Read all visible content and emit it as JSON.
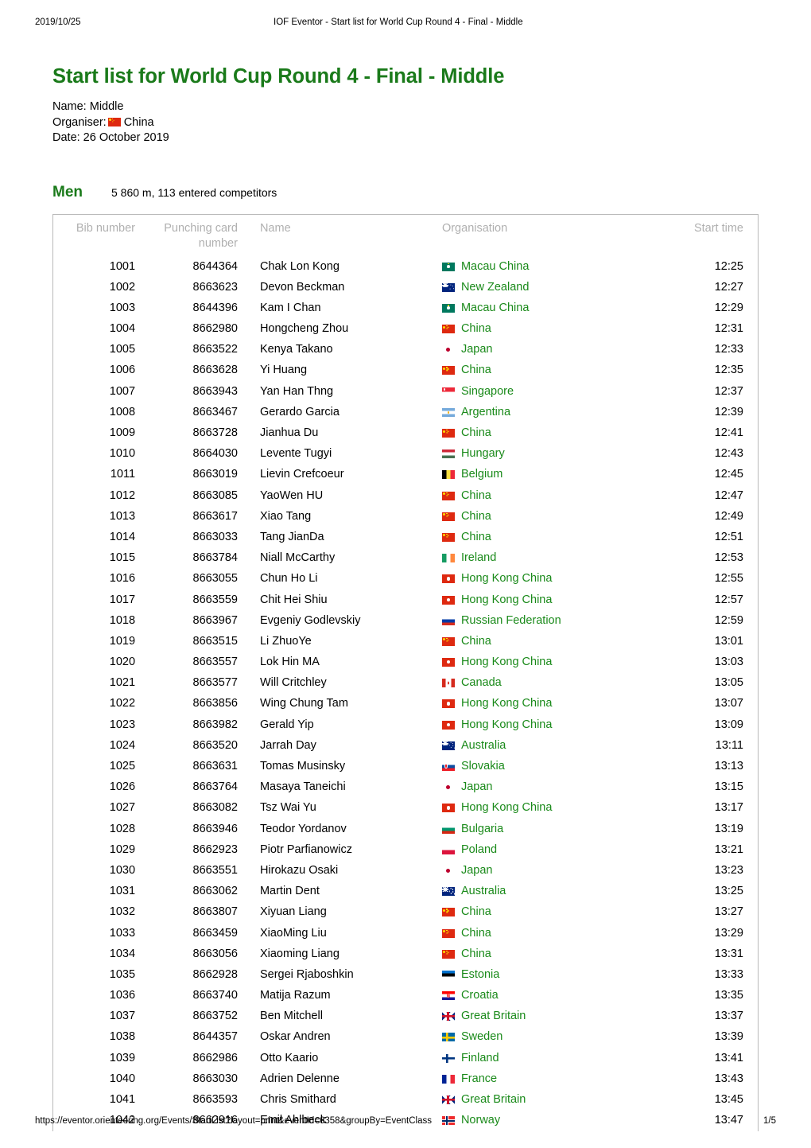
{
  "print_header": {
    "date": "2019/10/25",
    "title": "IOF Eventor - Start list for World Cup Round 4 - Final - Middle"
  },
  "print_footer": {
    "url": "https://eventor.orienteering.org/Events/StartList?layout=print&eventId=6358&groupBy=EventClass",
    "page": "1/5"
  },
  "document": {
    "title": "Start list for World Cup Round 4 - Final - Middle",
    "title_color": "#1a7a1a",
    "meta": {
      "name_label": "Name: Middle",
      "organiser_label": "Organiser:",
      "organiser_country": "China",
      "organiser_flag": "china-flag-icon",
      "date_label": "Date: 26 October 2019"
    }
  },
  "class_section": {
    "class_name": "Men",
    "class_info": "5 860 m, 113 entered competitors"
  },
  "table": {
    "headers": {
      "bib": "Bib number",
      "card": "Punching card number",
      "name": "Name",
      "organisation": "Organisation",
      "start_time": "Start time"
    },
    "header_color": "#b0b0b0",
    "link_color": "#1a8a1a",
    "rows": [
      {
        "bib": "1001",
        "card": "8644364",
        "name": "Chak Lon Kong",
        "org": "Macau China",
        "flag": "macau",
        "time": "12:25"
      },
      {
        "bib": "1002",
        "card": "8663623",
        "name": "Devon Beckman",
        "org": "New Zealand",
        "flag": "newzealand",
        "time": "12:27"
      },
      {
        "bib": "1003",
        "card": "8644396",
        "name": "Kam I Chan",
        "org": "Macau China",
        "flag": "macau",
        "time": "12:29"
      },
      {
        "bib": "1004",
        "card": "8662980",
        "name": "Hongcheng Zhou",
        "org": "China",
        "flag": "china",
        "time": "12:31"
      },
      {
        "bib": "1005",
        "card": "8663522",
        "name": "Kenya Takano",
        "org": "Japan",
        "flag": "japan",
        "time": "12:33"
      },
      {
        "bib": "1006",
        "card": "8663628",
        "name": "Yi Huang",
        "org": "China",
        "flag": "china",
        "time": "12:35"
      },
      {
        "bib": "1007",
        "card": "8663943",
        "name": "Yan Han Thng",
        "org": "Singapore",
        "flag": "singapore",
        "time": "12:37"
      },
      {
        "bib": "1008",
        "card": "8663467",
        "name": "Gerardo Garcia",
        "org": "Argentina",
        "flag": "argentina",
        "time": "12:39"
      },
      {
        "bib": "1009",
        "card": "8663728",
        "name": "Jianhua Du",
        "org": "China",
        "flag": "china",
        "time": "12:41"
      },
      {
        "bib": "1010",
        "card": "8664030",
        "name": "Levente Tugyi",
        "org": "Hungary",
        "flag": "hungary",
        "time": "12:43"
      },
      {
        "bib": "1011",
        "card": "8663019",
        "name": "Lievin Crefcoeur",
        "org": "Belgium",
        "flag": "belgium",
        "time": "12:45"
      },
      {
        "bib": "1012",
        "card": "8663085",
        "name": "YaoWen HU",
        "org": "China",
        "flag": "china",
        "time": "12:47"
      },
      {
        "bib": "1013",
        "card": "8663617",
        "name": "Xiao Tang",
        "org": "China",
        "flag": "china",
        "time": "12:49"
      },
      {
        "bib": "1014",
        "card": "8663033",
        "name": "Tang JianDa",
        "org": "China",
        "flag": "china",
        "time": "12:51"
      },
      {
        "bib": "1015",
        "card": "8663784",
        "name": "Niall McCarthy",
        "org": "Ireland",
        "flag": "ireland",
        "time": "12:53"
      },
      {
        "bib": "1016",
        "card": "8663055",
        "name": "Chun Ho Li",
        "org": "Hong Kong China",
        "flag": "hongkong",
        "time": "12:55"
      },
      {
        "bib": "1017",
        "card": "8663559",
        "name": "Chit Hei Shiu",
        "org": "Hong Kong China",
        "flag": "hongkong",
        "time": "12:57"
      },
      {
        "bib": "1018",
        "card": "8663967",
        "name": "Evgeniy Godlevskiy",
        "org": "Russian Federation",
        "flag": "russia",
        "time": "12:59"
      },
      {
        "bib": "1019",
        "card": "8663515",
        "name": "Li ZhuoYe",
        "org": "China",
        "flag": "china",
        "time": "13:01"
      },
      {
        "bib": "1020",
        "card": "8663557",
        "name": "Lok Hin MA",
        "org": "Hong Kong China",
        "flag": "hongkong",
        "time": "13:03"
      },
      {
        "bib": "1021",
        "card": "8663577",
        "name": "Will Critchley",
        "org": "Canada",
        "flag": "canada",
        "time": "13:05"
      },
      {
        "bib": "1022",
        "card": "8663856",
        "name": "Wing Chung Tam",
        "org": "Hong Kong China",
        "flag": "hongkong",
        "time": "13:07"
      },
      {
        "bib": "1023",
        "card": "8663982",
        "name": "Gerald Yip",
        "org": "Hong Kong China",
        "flag": "hongkong",
        "time": "13:09"
      },
      {
        "bib": "1024",
        "card": "8663520",
        "name": "Jarrah Day",
        "org": "Australia",
        "flag": "australia",
        "time": "13:11"
      },
      {
        "bib": "1025",
        "card": "8663631",
        "name": "Tomas Musinsky",
        "org": "Slovakia",
        "flag": "slovakia",
        "time": "13:13"
      },
      {
        "bib": "1026",
        "card": "8663764",
        "name": "Masaya Taneichi",
        "org": "Japan",
        "flag": "japan",
        "time": "13:15"
      },
      {
        "bib": "1027",
        "card": "8663082",
        "name": "Tsz Wai Yu",
        "org": "Hong Kong China",
        "flag": "hongkong",
        "time": "13:17"
      },
      {
        "bib": "1028",
        "card": "8663946",
        "name": "Teodor Yordanov",
        "org": "Bulgaria",
        "flag": "bulgaria",
        "time": "13:19"
      },
      {
        "bib": "1029",
        "card": "8662923",
        "name": "Piotr Parfianowicz",
        "org": "Poland",
        "flag": "poland",
        "time": "13:21"
      },
      {
        "bib": "1030",
        "card": "8663551",
        "name": "Hirokazu Osaki",
        "org": "Japan",
        "flag": "japan",
        "time": "13:23"
      },
      {
        "bib": "1031",
        "card": "8663062",
        "name": "Martin Dent",
        "org": "Australia",
        "flag": "australia",
        "time": "13:25"
      },
      {
        "bib": "1032",
        "card": "8663807",
        "name": "Xiyuan Liang",
        "org": "China",
        "flag": "china",
        "time": "13:27"
      },
      {
        "bib": "1033",
        "card": "8663459",
        "name": "XiaoMing Liu",
        "org": "China",
        "flag": "china",
        "time": "13:29"
      },
      {
        "bib": "1034",
        "card": "8663056",
        "name": "Xiaoming Liang",
        "org": "China",
        "flag": "china",
        "time": "13:31"
      },
      {
        "bib": "1035",
        "card": "8662928",
        "name": "Sergei Rjaboshkin",
        "org": "Estonia",
        "flag": "estonia",
        "time": "13:33"
      },
      {
        "bib": "1036",
        "card": "8663740",
        "name": "Matija Razum",
        "org": "Croatia",
        "flag": "croatia",
        "time": "13:35"
      },
      {
        "bib": "1037",
        "card": "8663752",
        "name": "Ben Mitchell",
        "org": "Great Britain",
        "flag": "greatbritain",
        "time": "13:37"
      },
      {
        "bib": "1038",
        "card": "8644357",
        "name": "Oskar Andren",
        "org": "Sweden",
        "flag": "sweden",
        "time": "13:39"
      },
      {
        "bib": "1039",
        "card": "8662986",
        "name": "Otto Kaario",
        "org": "Finland",
        "flag": "finland",
        "time": "13:41"
      },
      {
        "bib": "1040",
        "card": "8663030",
        "name": "Adrien Delenne",
        "org": "France",
        "flag": "france",
        "time": "13:43"
      },
      {
        "bib": "1041",
        "card": "8663593",
        "name": "Chris Smithard",
        "org": "Great Britain",
        "flag": "greatbritain",
        "time": "13:45"
      },
      {
        "bib": "1042",
        "card": "8662916",
        "name": "Emil Ahlbeck",
        "org": "Norway",
        "flag": "norway",
        "time": "13:47"
      }
    ]
  }
}
